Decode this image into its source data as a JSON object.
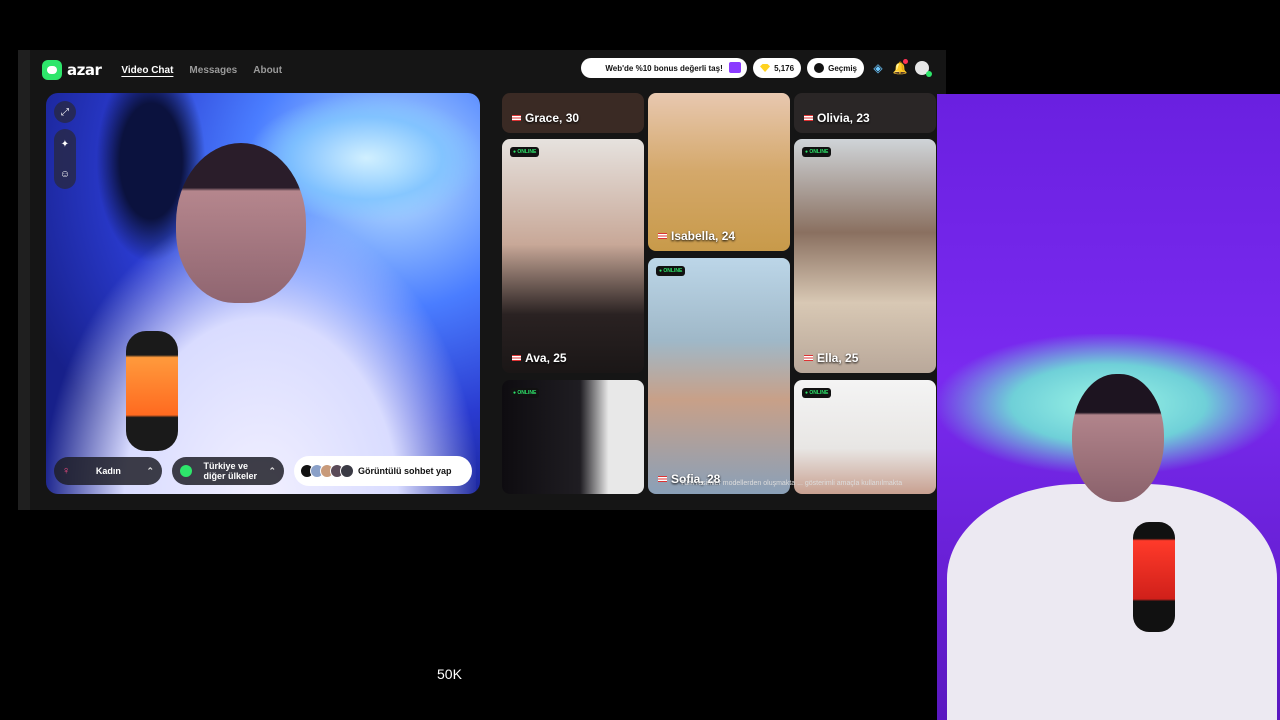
{
  "app": {
    "logo_text": "azar"
  },
  "nav": {
    "items": [
      "Video Chat",
      "Messages",
      "About"
    ]
  },
  "top_right": {
    "promo": "Web'de %10 bonus değerli taş!",
    "gems": "5,176",
    "history": "Geçmiş"
  },
  "controls": {
    "gender": "Kadın",
    "country_line1": "Türkiye ve",
    "country_line2": "diğer ülkeler",
    "start": "Görüntülü sohbet yap"
  },
  "grid": {
    "online_badge": "● ONLINE",
    "cards": [
      {
        "name": "Grace, 30",
        "color": "#3a2a24"
      },
      {
        "name": "Isabella, 24",
        "color": "#c89a4a"
      },
      {
        "name": "Olivia, 23",
        "color": "#2a2626"
      },
      {
        "name": "Ava, 25",
        "color": "#5a4a48"
      },
      {
        "name": "Sofia, 28",
        "color": "#9fb8c8"
      },
      {
        "name": "Ella, 25",
        "color": "#b9a89a"
      },
      {
        "name": "",
        "color": "#1f1d22"
      },
      {
        "name": "",
        "color": "#e8e6e4"
      }
    ],
    "caption": "Tüm resimler modellerden oluşmakta ... gösterimli amaçla kullanılmakta"
  },
  "counter": "50K",
  "colors": {
    "accent": "#2ee66b",
    "promo_gift": "#8b3bff",
    "gem": "#ffd21f"
  }
}
